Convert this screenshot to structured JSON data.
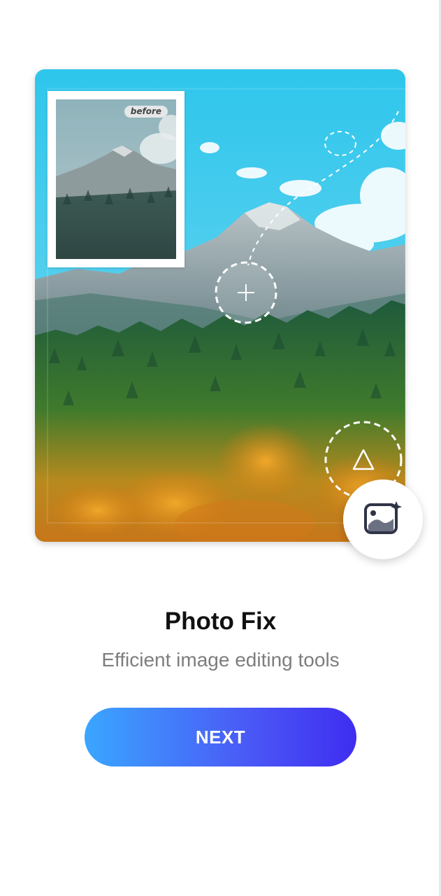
{
  "hero": {
    "before_label": "before"
  },
  "onboarding": {
    "title": "Photo Fix",
    "subtitle": "Efficient image editing tools",
    "next_label": "NEXT"
  },
  "icons": {
    "tool_add": "plus-icon",
    "tool_shape": "triangle-icon",
    "feature": "image-enhance-icon"
  },
  "colors": {
    "button_gradient_start": "#3aa6ff",
    "button_gradient_end": "#3f2df0",
    "title": "#111111",
    "subtitle": "#7d7d7d"
  }
}
